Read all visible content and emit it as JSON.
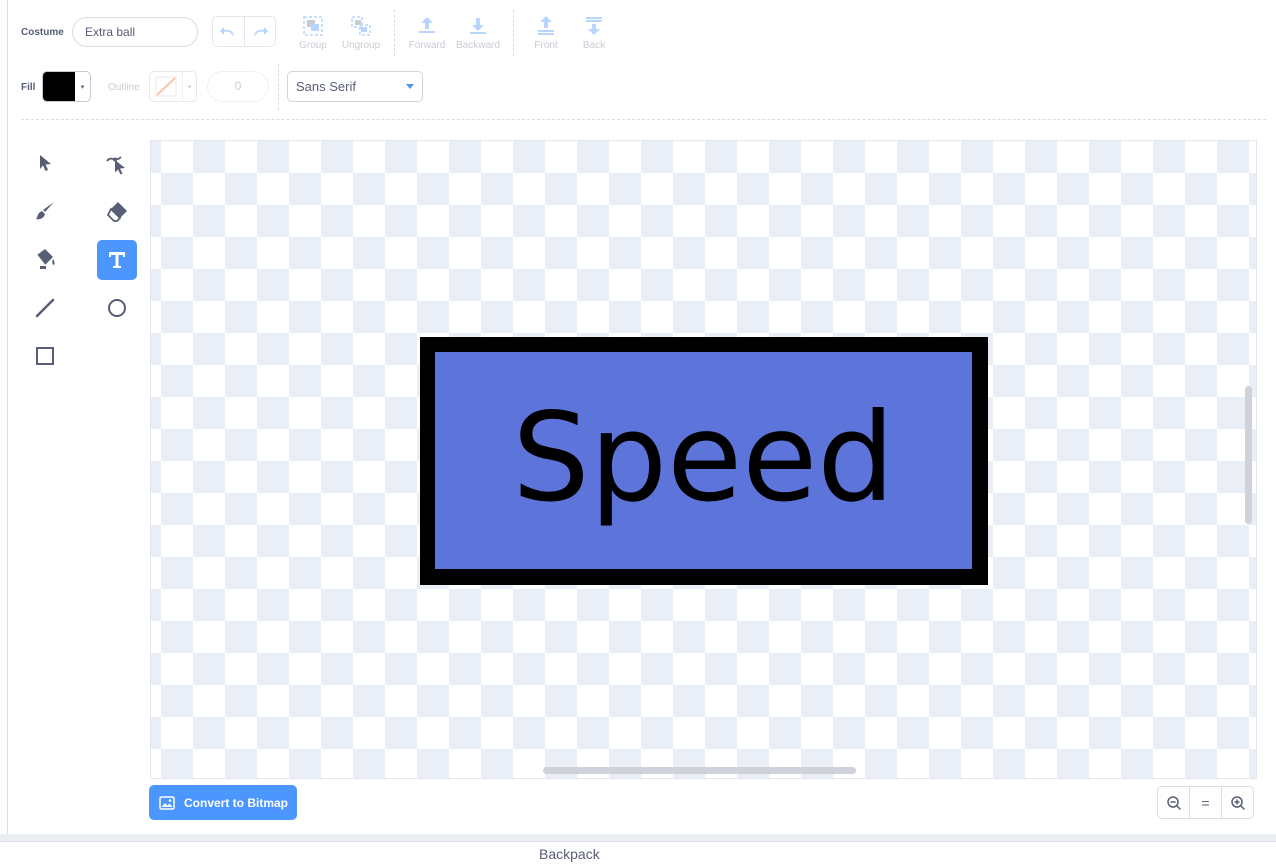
{
  "costume": {
    "label": "Costume",
    "name": "Extra ball"
  },
  "arrange": {
    "group": "Group",
    "ungroup": "Ungroup",
    "forward": "Forward",
    "backward": "Backward",
    "front": "Front",
    "back": "Back"
  },
  "style": {
    "fill_label": "Fill",
    "fill_color": "#000000",
    "outline_label": "Outline",
    "outline_width": "0",
    "font": "Sans Serif"
  },
  "tools": [
    {
      "name": "select",
      "icon": "arrow-icon"
    },
    {
      "name": "reshape",
      "icon": "reshape-icon"
    },
    {
      "name": "brush",
      "icon": "brush-icon"
    },
    {
      "name": "eraser",
      "icon": "eraser-icon"
    },
    {
      "name": "fill",
      "icon": "bucket-icon"
    },
    {
      "name": "text",
      "icon": "text-icon",
      "active": true
    },
    {
      "name": "line",
      "icon": "line-icon"
    },
    {
      "name": "circle",
      "icon": "circle-icon"
    },
    {
      "name": "rectangle",
      "icon": "rectangle-icon"
    }
  ],
  "canvas": {
    "text": "Speed",
    "fill_color": "#5d74db",
    "border_color": "#000000"
  },
  "convert_button": "Convert to Bitmap",
  "zoom": {
    "reset": "="
  },
  "backpack": "Backpack",
  "colors": {
    "accent": "#4c97ff",
    "text": "#575e75",
    "checker": "#e9eef7"
  }
}
